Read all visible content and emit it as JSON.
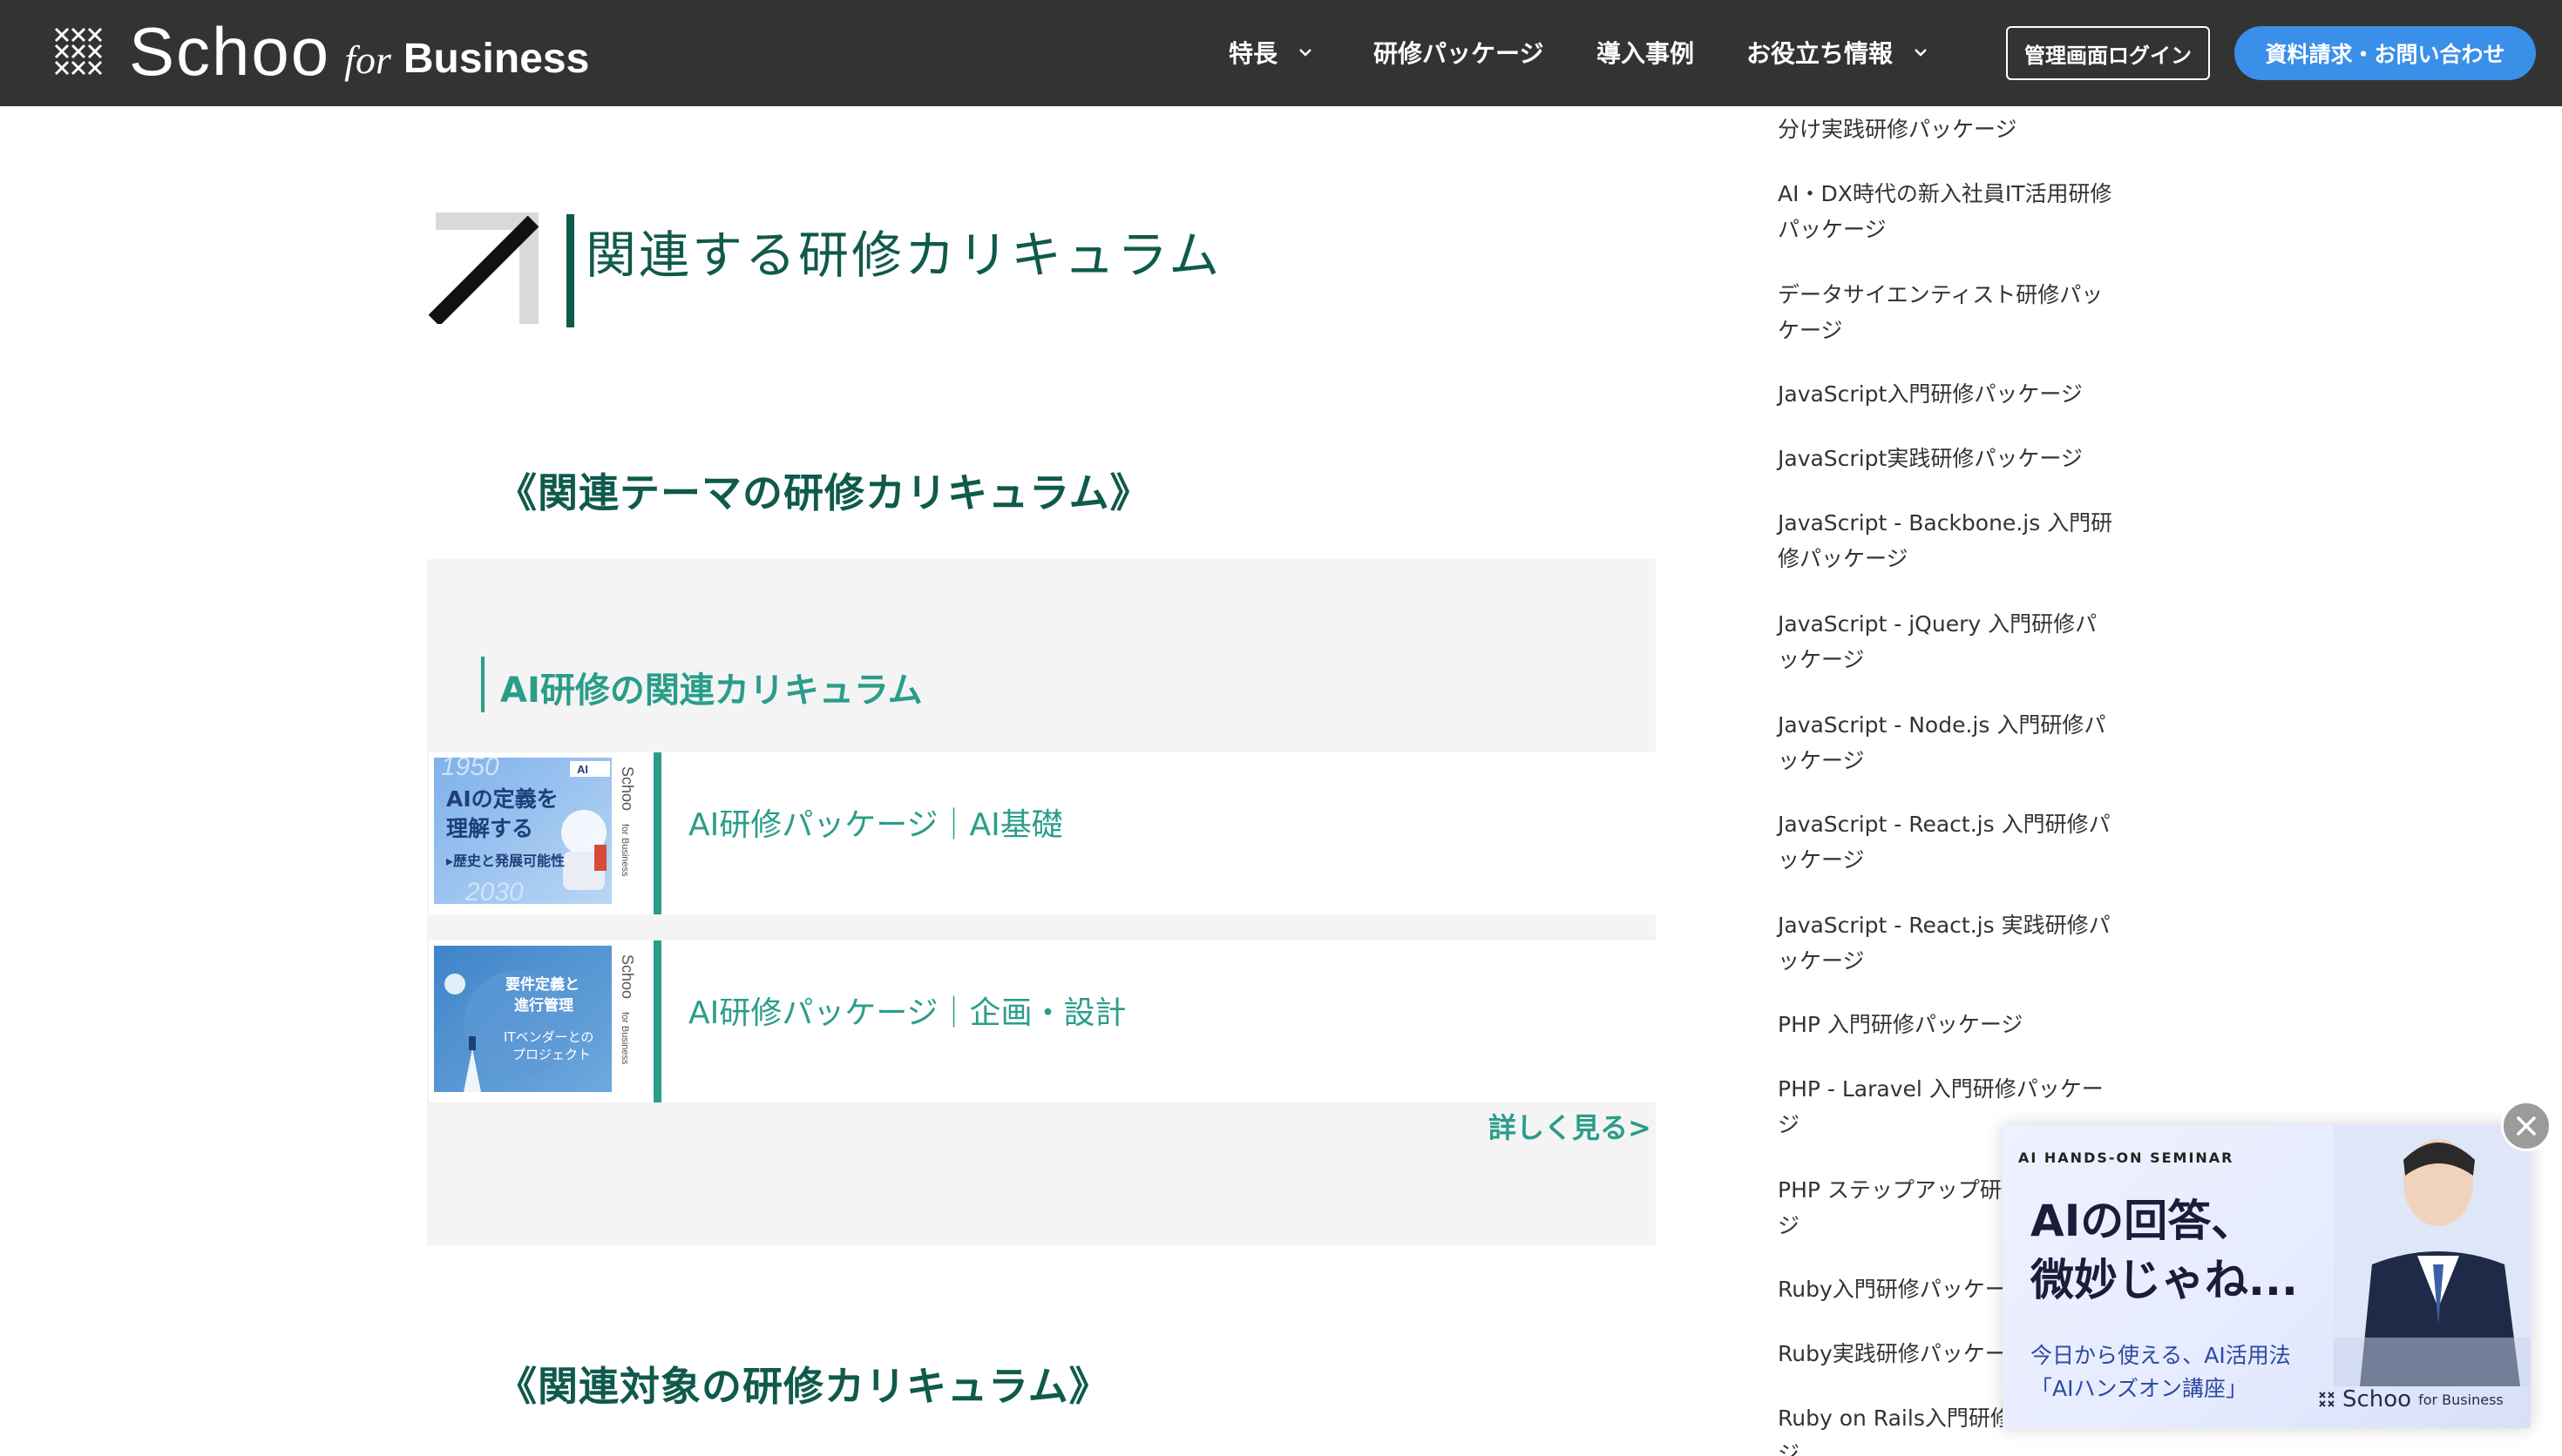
{
  "header": {
    "logo": {
      "word": "Schoo",
      "for": "for",
      "business": "Business"
    },
    "nav": [
      {
        "label": "特長",
        "has_dropdown": true
      },
      {
        "label": "研修パッケージ",
        "has_dropdown": false
      },
      {
        "label": "導入事例",
        "has_dropdown": false
      },
      {
        "label": "お役立ち情報",
        "has_dropdown": true
      }
    ],
    "login_button": "管理画面ログイン",
    "contact_button": "資料請求・お問い合わせ"
  },
  "main": {
    "section_title": "関連する研修カリキュラム",
    "theme_heading": "《関連テーマの研修カリキュラム》",
    "box_title": "AI研修の関連カリキュラム",
    "courses": [
      {
        "label": "AI研修パッケージ｜AI基礎",
        "thumb": {
          "line1": "AIの定義を",
          "line2": "理解する",
          "line3": "▸歴史と発展可能性",
          "years_top": "1950",
          "years_bottom": "2030",
          "badge": "AI"
        }
      },
      {
        "label": "AI研修パッケージ｜企画・設計",
        "thumb": {
          "line1": "要件定義と",
          "line2": "進行管理",
          "line3": "ITベンダーとの",
          "line4": "プロジェクト"
        }
      }
    ],
    "more_link": "詳しく見る>",
    "target_heading": "《関連対象の研修カリキュラム》"
  },
  "sidebar": {
    "items": [
      "分け実践研修パッケージ",
      "AI・DX時代の新入社員IT活用研修パッケージ",
      "データサイエンティスト研修パッケージ",
      "JavaScript入門研修パッケージ",
      "JavaScript実践研修パッケージ",
      "JavaScript - Backbone.js 入門研修パッケージ",
      "JavaScript - jQuery 入門研修パッケージ",
      "JavaScript - Node.js 入門研修パッケージ",
      "JavaScript - React.js 入門研修パッケージ",
      "JavaScript - React.js 実践研修パッケージ",
      "PHP 入門研修パッケージ",
      "PHP - Laravel 入門研修パッケージ",
      "PHP ステップアップ研修パッケージ",
      "Ruby入門研修パッケージ",
      "Ruby実践研修パッケージ",
      "Ruby on Rails入門研修パッケージ"
    ]
  },
  "popup": {
    "eyebrow": "AI HANDS-ON SEMINAR",
    "headline": "AIの回答、\n微妙じゃね...",
    "sub": "今日から使える、AI活用法\n「AIハンズオン講座」",
    "brand": "Schoo",
    "brand_for": "for Business"
  },
  "colors": {
    "header_bg": "#333333",
    "brand_green": "#0f5a4b",
    "accent_teal": "#2a9d8a",
    "contact_blue": "#3a8fe8",
    "box_bg": "#f4f4f4"
  }
}
